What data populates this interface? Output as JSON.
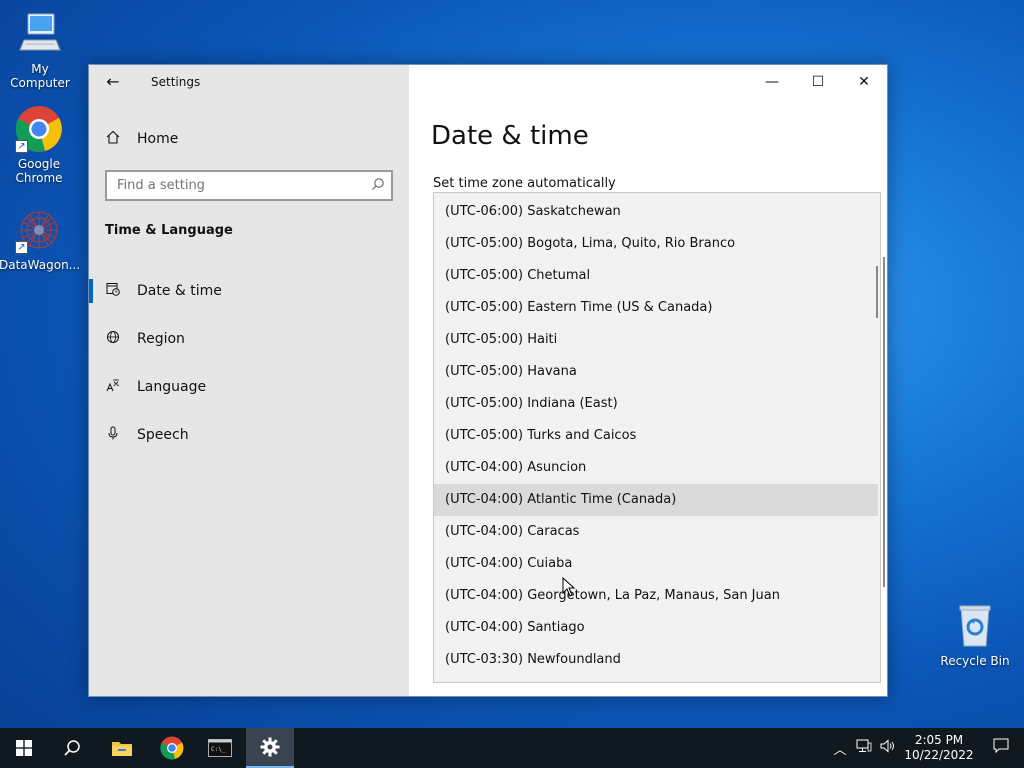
{
  "desktop": {
    "icons": [
      {
        "label": "My Computer",
        "icon": "computer-icon"
      },
      {
        "label": "Google Chrome",
        "icon": "chrome-icon"
      },
      {
        "label": "DataWagon...",
        "icon": "datawagon-icon"
      },
      {
        "label": "Recycle Bin",
        "icon": "recycle-bin-icon"
      }
    ]
  },
  "window": {
    "app_title": "Settings",
    "nav": {
      "home_label": "Home",
      "search_placeholder": "Find a setting",
      "group_label": "Time & Language",
      "items": [
        {
          "label": "Date & time",
          "icon": "calendar-clock-icon",
          "selected": true
        },
        {
          "label": "Region",
          "icon": "globe-icon"
        },
        {
          "label": "Language",
          "icon": "language-icon"
        },
        {
          "label": "Speech",
          "icon": "microphone-icon"
        }
      ]
    },
    "content": {
      "page_title": "Date & time",
      "tz_auto_label": "Set time zone automatically",
      "timezones": [
        "(UTC-06:00) Saskatchewan",
        "(UTC-05:00) Bogota, Lima, Quito, Rio Branco",
        "(UTC-05:00) Chetumal",
        "(UTC-05:00) Eastern Time (US & Canada)",
        "(UTC-05:00) Haiti",
        "(UTC-05:00) Havana",
        "(UTC-05:00) Indiana (East)",
        "(UTC-05:00) Turks and Caicos",
        "(UTC-04:00) Asuncion",
        "(UTC-04:00) Atlantic Time (Canada)",
        "(UTC-04:00) Caracas",
        "(UTC-04:00) Cuiaba",
        "(UTC-04:00) Georgetown, La Paz, Manaus, San Juan",
        "(UTC-04:00) Santiago",
        "(UTC-03:30) Newfoundland"
      ],
      "hovered_timezone": "(UTC-04:00) Atlantic Time (Canada)"
    }
  },
  "taskbar": {
    "time": "2:05 PM",
    "date": "10/22/2022"
  },
  "colors": {
    "accent": "#0067c0",
    "taskbar": "#101820"
  }
}
